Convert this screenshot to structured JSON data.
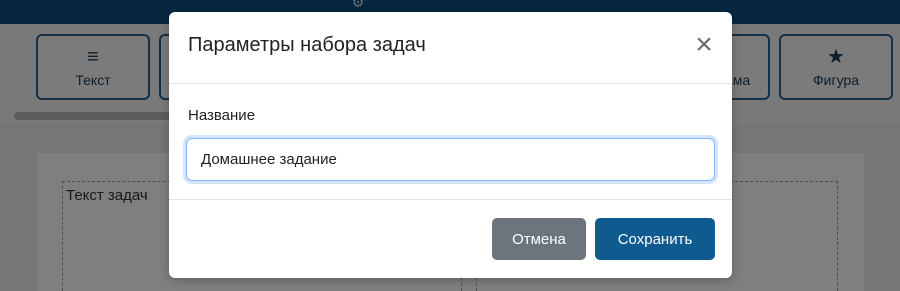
{
  "toolbar": {
    "text_label": "Текст",
    "scheme_label": "Схема",
    "scheme_visible": "има",
    "figure_label": "Фигура"
  },
  "workspace": {
    "task_text": "Текст задач"
  },
  "modal": {
    "title": "Параметры набора задач",
    "close_symbol": "×",
    "name_label": "Название",
    "name_value": "Домашнее задание",
    "cancel_label": "Отмена",
    "save_label": "Сохранить"
  },
  "colors": {
    "topbar": "#0f4f82",
    "save_button": "#0f5a8f",
    "cancel_button": "#6c757d",
    "input_focus": "#86b7fe"
  }
}
